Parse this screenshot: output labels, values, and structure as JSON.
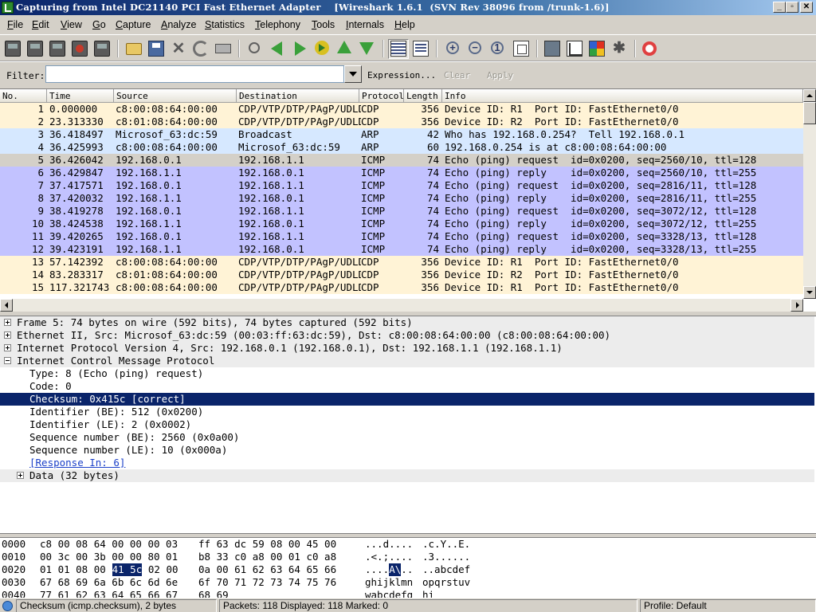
{
  "window": {
    "title": "Capturing from Intel DC21140 PCI Fast Ethernet Adapter    [Wireshark 1.6.1  (SVN Rev 38096 from /trunk-1.6)]",
    "minimize": "_",
    "maximize": "▫",
    "close": "✕"
  },
  "menu": [
    "File",
    "Edit",
    "View",
    "Go",
    "Capture",
    "Analyze",
    "Statistics",
    "Telephony",
    "Tools",
    "Internals",
    "Help"
  ],
  "toolbar": {
    "icons": [
      "interface-list-icon",
      "capture-options-icon",
      "start-capture-icon",
      "stop-capture-icon",
      "restart-capture-icon",
      "open-file-icon",
      "save-file-icon",
      "close-file-icon",
      "reload-icon",
      "print-icon",
      "find-packet-icon",
      "go-back-icon",
      "go-forward-icon",
      "go-to-packet-icon",
      "first-packet-icon",
      "last-packet-icon",
      "colorize-icon",
      "auto-scroll-icon",
      "zoom-in-icon",
      "zoom-out-icon",
      "normal-size-icon",
      "resize-columns-icon",
      "capture-filters-icon",
      "display-filters-icon",
      "coloring-rules-icon",
      "preferences-icon",
      "help-icon"
    ]
  },
  "filter": {
    "label": "Filter:",
    "value": "",
    "expression": "Expression...",
    "clear": "Clear",
    "apply": "Apply"
  },
  "packet_list": {
    "columns": [
      "No.",
      "Time",
      "Source",
      "Destination",
      "Protocol",
      "Length",
      "Info"
    ],
    "rows": [
      {
        "no": "1",
        "time": "0.000000",
        "src": "c8:00:08:64:00:00",
        "dst": "CDP/VTP/DTP/PAgP/UDLD",
        "proto": "CDP",
        "len": "356",
        "info": "Device ID: R1  Port ID: FastEthernet0/0",
        "color": "cdp"
      },
      {
        "no": "2",
        "time": "23.313330",
        "src": "c8:01:08:64:00:00",
        "dst": "CDP/VTP/DTP/PAgP/UDLD",
        "proto": "CDP",
        "len": "356",
        "info": "Device ID: R2  Port ID: FastEthernet0/0",
        "color": "cdp"
      },
      {
        "no": "3",
        "time": "36.418497",
        "src": "Microsof_63:dc:59",
        "dst": "Broadcast",
        "proto": "ARP",
        "len": "42",
        "info": "Who has 192.168.0.254?  Tell 192.168.0.1",
        "color": "arp"
      },
      {
        "no": "4",
        "time": "36.425993",
        "src": "c8:00:08:64:00:00",
        "dst": "Microsof_63:dc:59",
        "proto": "ARP",
        "len": "60",
        "info": "192.168.0.254 is at c8:00:08:64:00:00",
        "color": "arp"
      },
      {
        "no": "5",
        "time": "36.426042",
        "src": "192.168.0.1",
        "dst": "192.168.1.1",
        "proto": "ICMP",
        "len": "74",
        "info": "Echo (ping) request  id=0x0200, seq=2560/10, ttl=128",
        "color": "selgray"
      },
      {
        "no": "6",
        "time": "36.429847",
        "src": "192.168.1.1",
        "dst": "192.168.0.1",
        "proto": "ICMP",
        "len": "74",
        "info": "Echo (ping) reply    id=0x0200, seq=2560/10, ttl=255",
        "color": "icmp"
      },
      {
        "no": "7",
        "time": "37.417571",
        "src": "192.168.0.1",
        "dst": "192.168.1.1",
        "proto": "ICMP",
        "len": "74",
        "info": "Echo (ping) request  id=0x0200, seq=2816/11, ttl=128",
        "color": "icmp"
      },
      {
        "no": "8",
        "time": "37.420032",
        "src": "192.168.1.1",
        "dst": "192.168.0.1",
        "proto": "ICMP",
        "len": "74",
        "info": "Echo (ping) reply    id=0x0200, seq=2816/11, ttl=255",
        "color": "icmp"
      },
      {
        "no": "9",
        "time": "38.419278",
        "src": "192.168.0.1",
        "dst": "192.168.1.1",
        "proto": "ICMP",
        "len": "74",
        "info": "Echo (ping) request  id=0x0200, seq=3072/12, ttl=128",
        "color": "icmp"
      },
      {
        "no": "10",
        "time": "38.424538",
        "src": "192.168.1.1",
        "dst": "192.168.0.1",
        "proto": "ICMP",
        "len": "74",
        "info": "Echo (ping) reply    id=0x0200, seq=3072/12, ttl=255",
        "color": "icmp"
      },
      {
        "no": "11",
        "time": "39.420265",
        "src": "192.168.0.1",
        "dst": "192.168.1.1",
        "proto": "ICMP",
        "len": "74",
        "info": "Echo (ping) request  id=0x0200, seq=3328/13, ttl=128",
        "color": "icmp"
      },
      {
        "no": "12",
        "time": "39.423191",
        "src": "192.168.1.1",
        "dst": "192.168.0.1",
        "proto": "ICMP",
        "len": "74",
        "info": "Echo (ping) reply    id=0x0200, seq=3328/13, ttl=255",
        "color": "icmp"
      },
      {
        "no": "13",
        "time": "57.142392",
        "src": "c8:00:08:64:00:00",
        "dst": "CDP/VTP/DTP/PAgP/UDLD",
        "proto": "CDP",
        "len": "356",
        "info": "Device ID: R1  Port ID: FastEthernet0/0",
        "color": "cdp"
      },
      {
        "no": "14",
        "time": "83.283317",
        "src": "c8:01:08:64:00:00",
        "dst": "CDP/VTP/DTP/PAgP/UDLD",
        "proto": "CDP",
        "len": "356",
        "info": "Device ID: R2  Port ID: FastEthernet0/0",
        "color": "cdp"
      },
      {
        "no": "15",
        "time": "117.321743",
        "src": "c8:00:08:64:00:00",
        "dst": "CDP/VTP/DTP/PAgP/UDLD",
        "proto": "CDP",
        "len": "356",
        "info": "Device ID: R1  Port ID: FastEthernet0/0",
        "color": "cdp"
      }
    ]
  },
  "row_colors": {
    "cdp": "#fff3d6",
    "arp": "#d6e8ff",
    "icmp": "#c2c2ff",
    "selgray": "#d4d0c8"
  },
  "details": [
    {
      "text": "Frame 5: 74 bytes on wire (592 bits), 74 bytes captured (592 bits)",
      "indent": 0,
      "exp": "plus",
      "style": "gray"
    },
    {
      "text": "Ethernet II, Src: Microsof_63:dc:59 (00:03:ff:63:dc:59), Dst: c8:00:08:64:00:00 (c8:00:08:64:00:00)",
      "indent": 0,
      "exp": "plus",
      "style": "gray"
    },
    {
      "text": "Internet Protocol Version 4, Src: 192.168.0.1 (192.168.0.1), Dst: 192.168.1.1 (192.168.1.1)",
      "indent": 0,
      "exp": "plus",
      "style": "gray"
    },
    {
      "text": "Internet Control Message Protocol",
      "indent": 0,
      "exp": "minus",
      "style": "gray"
    },
    {
      "text": "Type: 8 (Echo (ping) request)",
      "indent": 1,
      "exp": "",
      "style": ""
    },
    {
      "text": "Code: 0",
      "indent": 1,
      "exp": "",
      "style": ""
    },
    {
      "text": "Checksum: 0x415c [correct]",
      "indent": 1,
      "exp": "",
      "style": "sel"
    },
    {
      "text": "Identifier (BE): 512 (0x0200)",
      "indent": 1,
      "exp": "",
      "style": ""
    },
    {
      "text": "Identifier (LE): 2 (0x0002)",
      "indent": 1,
      "exp": "",
      "style": ""
    },
    {
      "text": "Sequence number (BE): 2560 (0x0a00)",
      "indent": 1,
      "exp": "",
      "style": ""
    },
    {
      "text": "Sequence number (LE): 10 (0x000a)",
      "indent": 1,
      "exp": "",
      "style": ""
    },
    {
      "text": "[Response In: 6]",
      "indent": 1,
      "exp": "",
      "style": "link"
    },
    {
      "text": "Data (32 bytes)",
      "indent": 1,
      "exp": "plus",
      "style": "gray"
    }
  ],
  "bytes": [
    {
      "off": "0000",
      "hex_a": "c8 00 08 64 00 00 00 03",
      "hex_b": "ff 63 dc 59 08 00 45 00",
      "ascii_a": "...d....",
      "ascii_b": ".c.Y..E."
    },
    {
      "off": "0010",
      "hex_a": "00 3c 00 3b 00 00 80 01",
      "hex_b": "b8 33 c0 a8 00 01 c0 a8",
      "ascii_a": ".<.;....",
      "ascii_b": ".3......"
    },
    {
      "off": "0020",
      "hex_pre": "01 01 08 00 ",
      "hex_hl": "41 5c",
      "hex_post": " 02 00",
      "hex_b": "0a 00 61 62 63 64 65 66",
      "ascii_pre": "....",
      "ascii_hl": "A\\",
      "ascii_post": "..",
      "ascii_b": "..abcdef"
    },
    {
      "off": "0030",
      "hex_a": "67 68 69 6a 6b 6c 6d 6e",
      "hex_b": "6f 70 71 72 73 74 75 76",
      "ascii_a": "ghijklmn",
      "ascii_b": "opqrstuv"
    },
    {
      "off": "0040",
      "hex_a": "77 61 62 63 64 65 66 67",
      "hex_b": "68 69",
      "ascii_a": "wabcdefg",
      "ascii_b": "hi"
    }
  ],
  "status": {
    "field": "Checksum (icmp.checksum), 2 bytes",
    "packets": "Packets: 118 Displayed: 118 Marked: 0",
    "profile": "Profile: Default"
  }
}
